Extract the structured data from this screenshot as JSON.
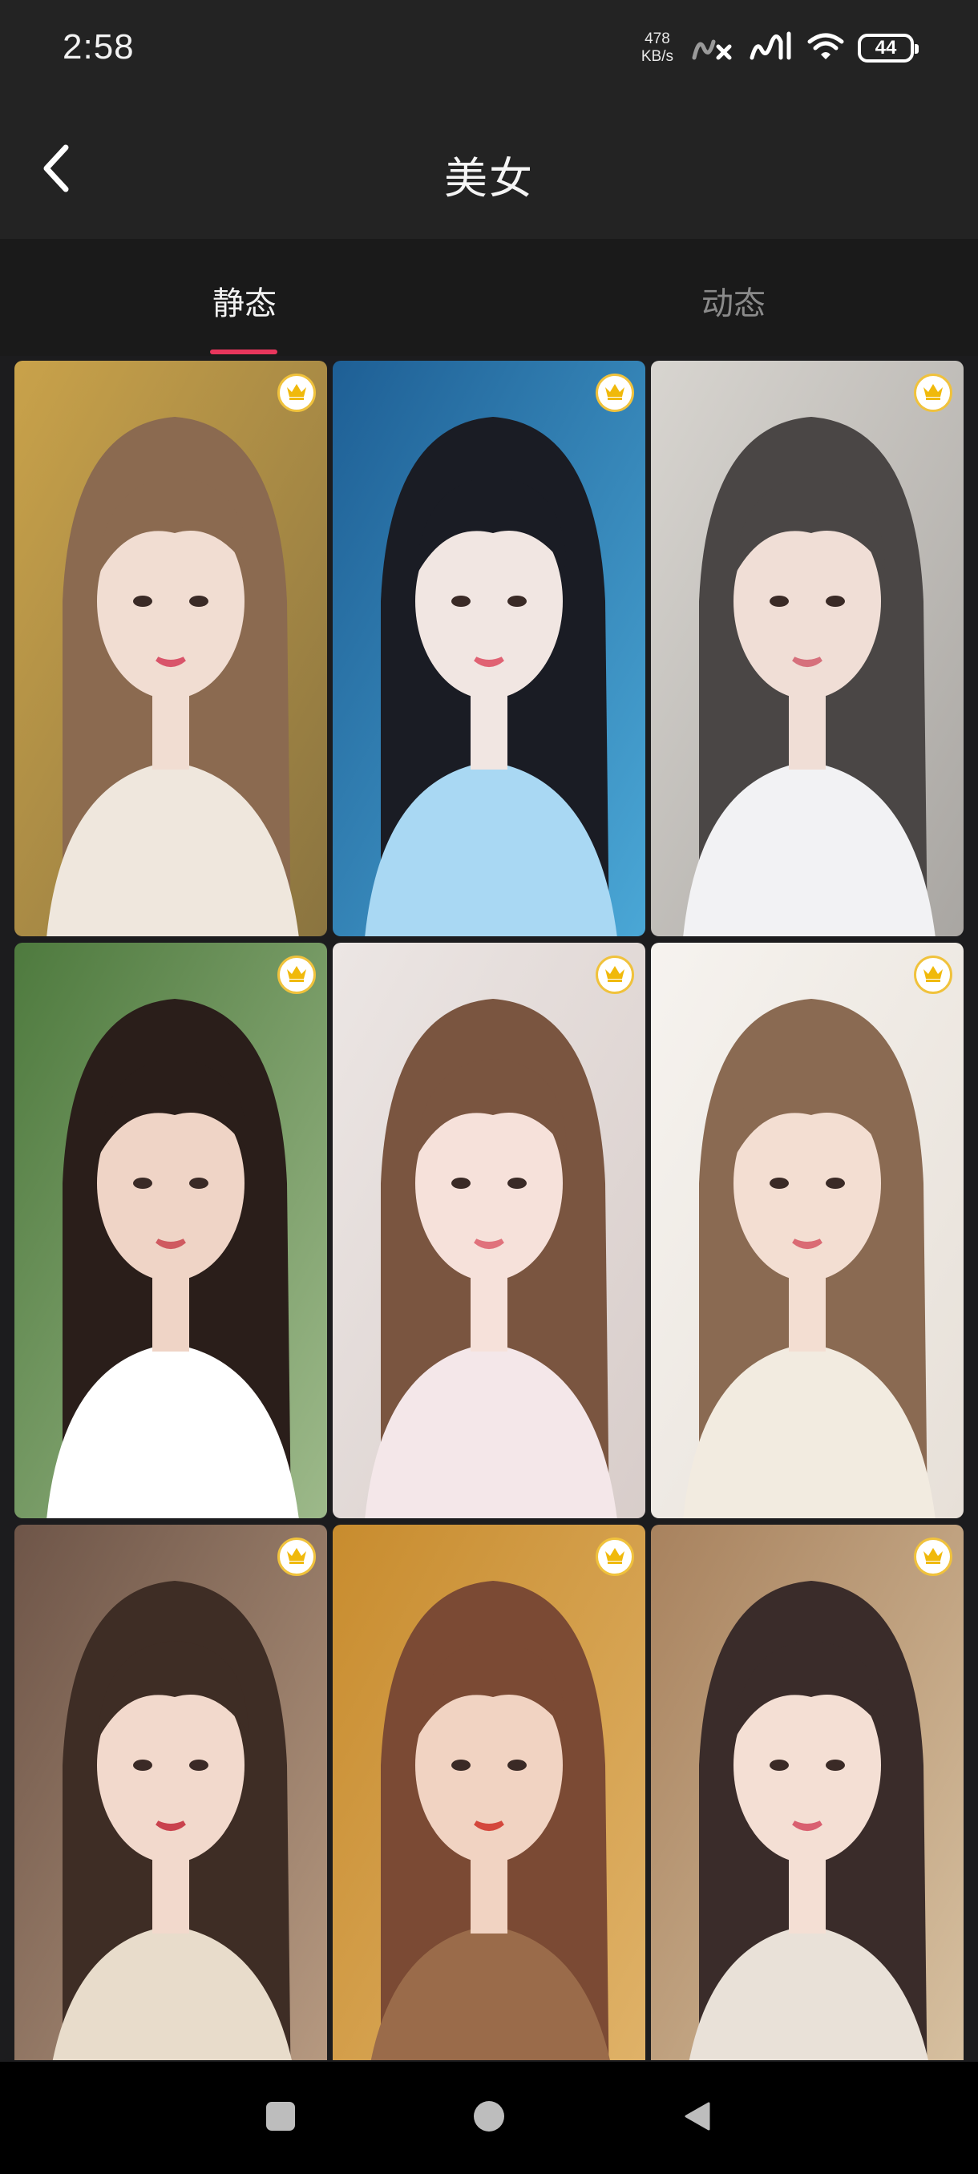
{
  "status_bar": {
    "time": "2:58",
    "net_speed_value": "478",
    "net_speed_unit": "KB/s",
    "battery": "44"
  },
  "header": {
    "title": "美女",
    "back_icon": "chevron-left-icon"
  },
  "tabs": [
    {
      "label": "静态",
      "active": true
    },
    {
      "label": "动态",
      "active": false
    }
  ],
  "accent_color": "#e8365d",
  "badge_icon": "crown-icon",
  "wallpapers": [
    {
      "premium": true,
      "palette": {
        "bg1": "#c9a24a",
        "bg2": "#8a7440",
        "hair": "#8b6a50",
        "skin": "#f1ddd2",
        "cloth": "#efe7dd",
        "lip": "#d9546a"
      }
    },
    {
      "premium": true,
      "palette": {
        "bg1": "#1e5f95",
        "bg2": "#4aa7d6",
        "hair": "#1a1c24",
        "skin": "#f1e6e2",
        "cloth": "#a9d8f3",
        "lip": "#e06273"
      }
    },
    {
      "premium": true,
      "palette": {
        "bg1": "#d8d5d0",
        "bg2": "#a9a6a2",
        "hair": "#4a4645",
        "skin": "#f0ded6",
        "cloth": "#f2f2f4",
        "lip": "#d6707c"
      }
    },
    {
      "premium": true,
      "palette": {
        "bg1": "#4e7a3e",
        "bg2": "#9db98a",
        "hair": "#2a1e1a",
        "skin": "#efd4c6",
        "cloth": "#ffffff",
        "lip": "#cf5a60"
      }
    },
    {
      "premium": true,
      "palette": {
        "bg1": "#ece6e4",
        "bg2": "#d8cdca",
        "hair": "#7a5540",
        "skin": "#f6e1da",
        "cloth": "#f4e7e9",
        "lip": "#e0727c"
      }
    },
    {
      "premium": true,
      "palette": {
        "bg1": "#f6f3ef",
        "bg2": "#e7e0d8",
        "hair": "#8a6a52",
        "skin": "#f3ded2",
        "cloth": "#f2ebe0",
        "lip": "#da6b74"
      }
    },
    {
      "premium": true,
      "palette": {
        "bg1": "#6e5548",
        "bg2": "#b89b82",
        "hair": "#3e2d25",
        "skin": "#f2d9cc",
        "cloth": "#e8dccb",
        "lip": "#c9424d"
      }
    },
    {
      "premium": true,
      "palette": {
        "bg1": "#c88c2e",
        "bg2": "#e0b36a",
        "hair": "#7b4a34",
        "skin": "#f1d3c2",
        "cloth": "#9a6b4a",
        "lip": "#d4473c"
      }
    },
    {
      "premium": true,
      "palette": {
        "bg1": "#a8825e",
        "bg2": "#d8c2a2",
        "hair": "#3a2c2a",
        "skin": "#f4dfd4",
        "cloth": "#e9e1d8",
        "lip": "#d96070"
      }
    }
  ]
}
